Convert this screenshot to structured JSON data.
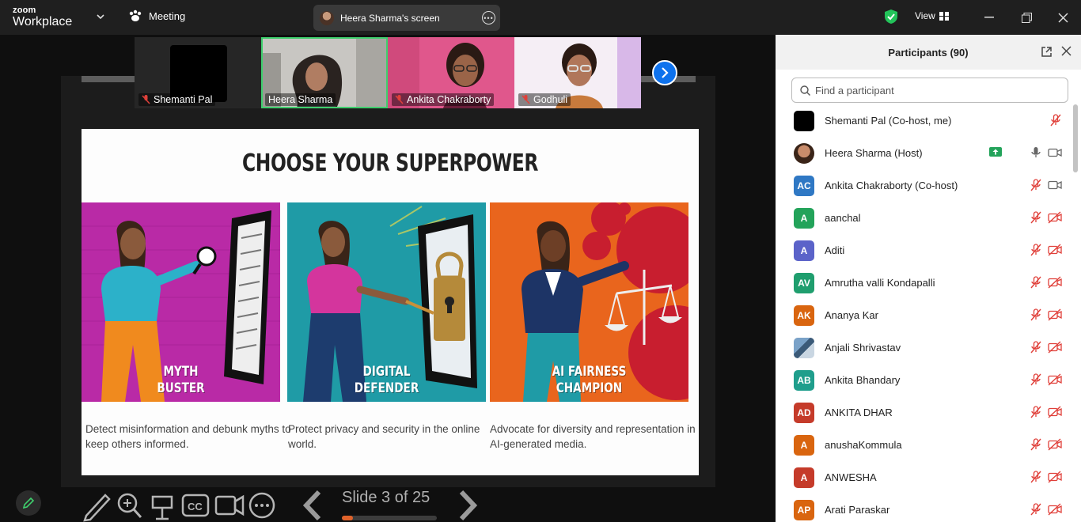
{
  "titlebar": {
    "logo_top": "zoom",
    "logo_bottom": "Workplace",
    "meeting_label": "Meeting",
    "shared_screen_label": "Heera Sharma's screen",
    "view_label": "View"
  },
  "thumbnails": [
    {
      "name": "Shemanti Pal",
      "muted": true
    },
    {
      "name": "Heera Sharma",
      "muted": false,
      "active": true
    },
    {
      "name": "Ankita Chakraborty",
      "muted": true
    },
    {
      "name": "Godhuli",
      "muted": true
    }
  ],
  "slide": {
    "title": "CHOOSE YOUR SUPERPOWER",
    "panels": [
      {
        "label_line1": "MYTH",
        "label_line2": "BUSTER",
        "description": "Detect misinformation and debunk myths to keep others informed."
      },
      {
        "label_line1": "DIGITAL",
        "label_line2": "DEFENDER",
        "description": "Protect privacy and security in the online world."
      },
      {
        "label_line1": "AI FAIRNESS",
        "label_line2": "CHAMPION",
        "description": "Advocate for diversity and representation in AI-generated media."
      }
    ]
  },
  "presentation": {
    "counter": "Slide 3 of 25",
    "progress_fraction": 0.12
  },
  "participants": {
    "header": "Participants (90)",
    "search_placeholder": "Find a participant",
    "list": [
      {
        "initials": "",
        "name": "Shemanti Pal (Co-host, me)",
        "color": "#000000",
        "type": "black",
        "mic": "muted",
        "video": "none"
      },
      {
        "initials": "",
        "name": "Heera Sharma (Host)",
        "color": "#c98c6b",
        "type": "photo",
        "mic": "on",
        "video": "on",
        "share": true
      },
      {
        "initials": "AC",
        "name": "Ankita Chakraborty (Co-host)",
        "color": "#2f78c4",
        "type": "initials",
        "mic": "muted",
        "video": "on"
      },
      {
        "initials": "A",
        "name": "aanchal",
        "color": "#23a35a",
        "type": "initials",
        "mic": "muted",
        "video": "off"
      },
      {
        "initials": "A",
        "name": "Aditi",
        "color": "#5b63c9",
        "type": "initials",
        "mic": "muted",
        "video": "off"
      },
      {
        "initials": "AV",
        "name": "Amrutha valli Kondapalli",
        "color": "#1f9e6e",
        "type": "initials",
        "mic": "muted",
        "video": "off"
      },
      {
        "initials": "AK",
        "name": "Ananya Kar",
        "color": "#d9650f",
        "type": "initials",
        "mic": "muted",
        "video": "off"
      },
      {
        "initials": "",
        "name": "Anjali Shrivastav",
        "color": "#6a8fb4",
        "type": "photo2",
        "mic": "muted",
        "video": "off"
      },
      {
        "initials": "AB",
        "name": "Ankita Bhandary",
        "color": "#1f9e8c",
        "type": "initials",
        "mic": "muted",
        "video": "off"
      },
      {
        "initials": "AD",
        "name": "ANKITA DHAR",
        "color": "#c53b2a",
        "type": "initials",
        "mic": "muted",
        "video": "off"
      },
      {
        "initials": "A",
        "name": "anushaKommula",
        "color": "#d9650f",
        "type": "initials",
        "mic": "muted",
        "video": "off"
      },
      {
        "initials": "A",
        "name": "ANWESHA",
        "color": "#c53b2a",
        "type": "initials",
        "mic": "muted",
        "video": "off"
      },
      {
        "initials": "AP",
        "name": "Arati Paraskar",
        "color": "#d9650f",
        "type": "initials",
        "mic": "muted",
        "video": "off"
      }
    ]
  },
  "colors": {
    "accent_blue": "#0e72ed",
    "active_green": "#3fcf6d",
    "muted_red": "#e0403a"
  },
  "icons": [
    "chevron-down-icon",
    "paw-icon",
    "more-icon",
    "shield-icon",
    "grid-icon",
    "minimize-icon",
    "maximize-icon",
    "close-icon",
    "pen-icon",
    "zoom-icon",
    "pointer-icon",
    "cc-icon",
    "video-icon",
    "ellipsis-icon",
    "prev-arrow-icon",
    "next-arrow-icon",
    "search-icon",
    "popout-icon",
    "mic-muted-icon",
    "mic-icon",
    "video-off-icon",
    "share-icon"
  ]
}
